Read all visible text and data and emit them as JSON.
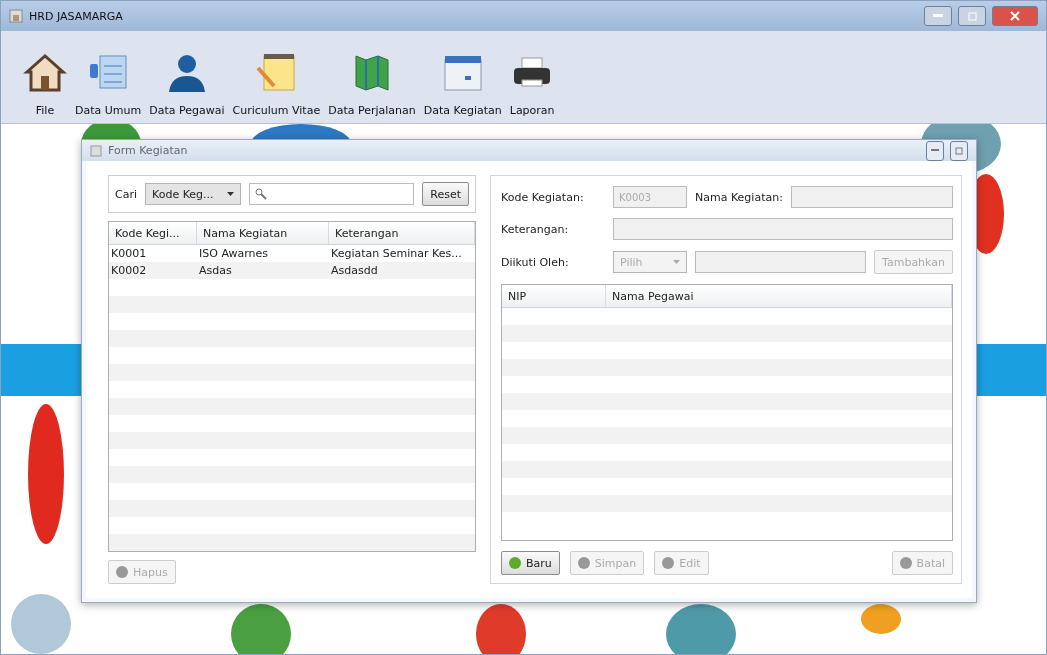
{
  "window": {
    "title": "HRD JASAMARGA"
  },
  "toolbar": [
    {
      "label": "File",
      "kind": "house"
    },
    {
      "label": "Data Umum",
      "kind": "panel"
    },
    {
      "label": "Data Pegawai",
      "kind": "person"
    },
    {
      "label": "Curiculum Vitae",
      "kind": "notepad"
    },
    {
      "label": "Data Perjalanan",
      "kind": "map"
    },
    {
      "label": "Data Kegiatan",
      "kind": "calendar"
    },
    {
      "label": "Laporan",
      "kind": "printer"
    }
  ],
  "form": {
    "title": "Form Kegiatan",
    "search": {
      "label": "Cari",
      "filter": "Kode Keg...",
      "reset": "Reset"
    },
    "list_table": {
      "columns": [
        "Kode Kegi...",
        "Nama Kegiatan",
        "Keterangan"
      ],
      "rows": [
        [
          "K0001",
          "ISO Awarnes",
          "Kegiatan Seminar Kes..."
        ],
        [
          "K0002",
          "Asdas",
          "Asdasdd"
        ]
      ]
    },
    "delete_button": {
      "label": "Hapus",
      "disabled": true
    },
    "fields": {
      "kode_label": "Kode Kegiatan:",
      "kode_value": "K0003",
      "nama_label": "Nama Kegiatan:",
      "keterangan_label": "Keterangan:",
      "diikuti_label": "Diikuti Oleh:",
      "diikuti_select": "Pilih",
      "add_button": "Tambahkan",
      "disabled": true
    },
    "member_table": {
      "columns": [
        "NIP",
        "Nama Pegawai"
      ]
    },
    "buttons": [
      {
        "label": "Baru",
        "disabled": false
      },
      {
        "label": "Simpan",
        "disabled": true
      },
      {
        "label": "Edit",
        "disabled": true
      }
    ],
    "cancel_button": {
      "label": "Batal",
      "disabled": true
    }
  }
}
